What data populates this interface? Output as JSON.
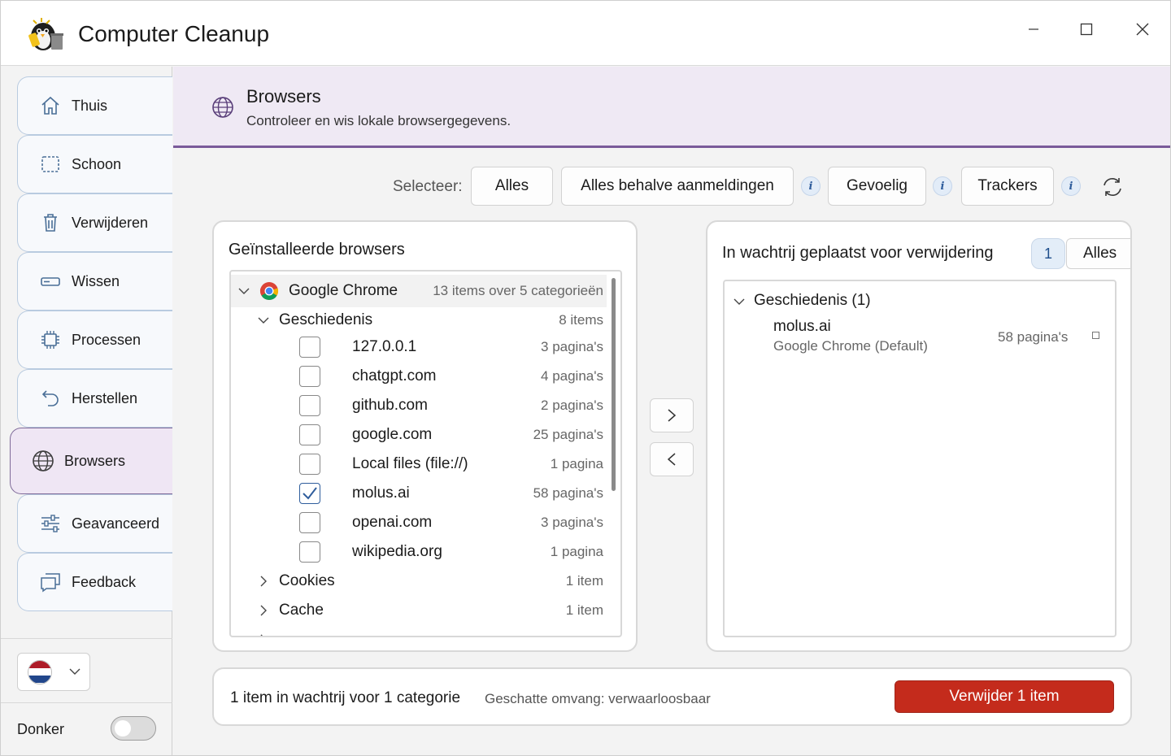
{
  "app": {
    "title": "Computer Cleanup"
  },
  "sidebar": {
    "items": [
      {
        "label": "Thuis",
        "icon": "home-icon"
      },
      {
        "label": "Schoon",
        "icon": "clean-icon"
      },
      {
        "label": "Verwijderen",
        "icon": "trash-icon"
      },
      {
        "label": "Wissen",
        "icon": "erase-icon"
      },
      {
        "label": "Processen",
        "icon": "cpu-icon"
      },
      {
        "label": "Herstellen",
        "icon": "undo-icon"
      },
      {
        "label": "Browsers",
        "icon": "globe-icon",
        "active": true
      },
      {
        "label": "Geavanceerd",
        "icon": "sliders-icon"
      },
      {
        "label": "Feedback",
        "icon": "feedback-icon"
      }
    ],
    "dark_label": "Donker",
    "dark_enabled": false,
    "language_flag": "flag-nl-icon"
  },
  "banner": {
    "title": "Browsers",
    "subtitle": "Controleer en wis lokale browsergegevens."
  },
  "toolbar": {
    "select_label": "Selecteer:",
    "buttons": [
      "Alles",
      "Alles behalve aanmeldingen",
      "Gevoelig",
      "Trackers"
    ],
    "info_glyph": "i"
  },
  "installed": {
    "title": "Geïnstalleerde browsers",
    "browser": {
      "name": "Google Chrome",
      "count": "13 items over 5 categorieën"
    },
    "history": {
      "label": "Geschiedenis",
      "count": "8 items",
      "entries": [
        {
          "site": "127.0.0.1",
          "count": "3 pagina's",
          "checked": false
        },
        {
          "site": "chatgpt.com",
          "count": "4 pagina's",
          "checked": false
        },
        {
          "site": "github.com",
          "count": "2 pagina's",
          "checked": false
        },
        {
          "site": "google.com",
          "count": "25 pagina's",
          "checked": false
        },
        {
          "site": "Local files (file://)",
          "count": "1 pagina",
          "checked": false
        },
        {
          "site": "molus.ai",
          "count": "58 pagina's",
          "checked": true
        },
        {
          "site": "openai.com",
          "count": "3 pagina's",
          "checked": false
        },
        {
          "site": "wikipedia.org",
          "count": "1 pagina",
          "checked": false
        }
      ]
    },
    "categories": [
      {
        "label": "Cookies",
        "count": "1 item"
      },
      {
        "label": "Cache",
        "count": "1 item"
      }
    ]
  },
  "queue": {
    "title": "In wachtrij geplaatst voor verwijdering",
    "badge": "1",
    "all_label": "Alles",
    "group": "Geschiedenis (1)",
    "item_name": "molus.ai",
    "item_source": "Google Chrome (Default)",
    "item_count": "58 pagina's"
  },
  "footer": {
    "summary": "1 item in wachtrij voor 1 categorie",
    "size": "Geschatte omvang: verwaarloosbaar",
    "delete_label": "Verwijder 1 item"
  },
  "colors": {
    "accent": "#7a5a9a",
    "banner_bg": "#efe9f4",
    "delete": "#c42b1c",
    "check": "#2f5d9c"
  }
}
